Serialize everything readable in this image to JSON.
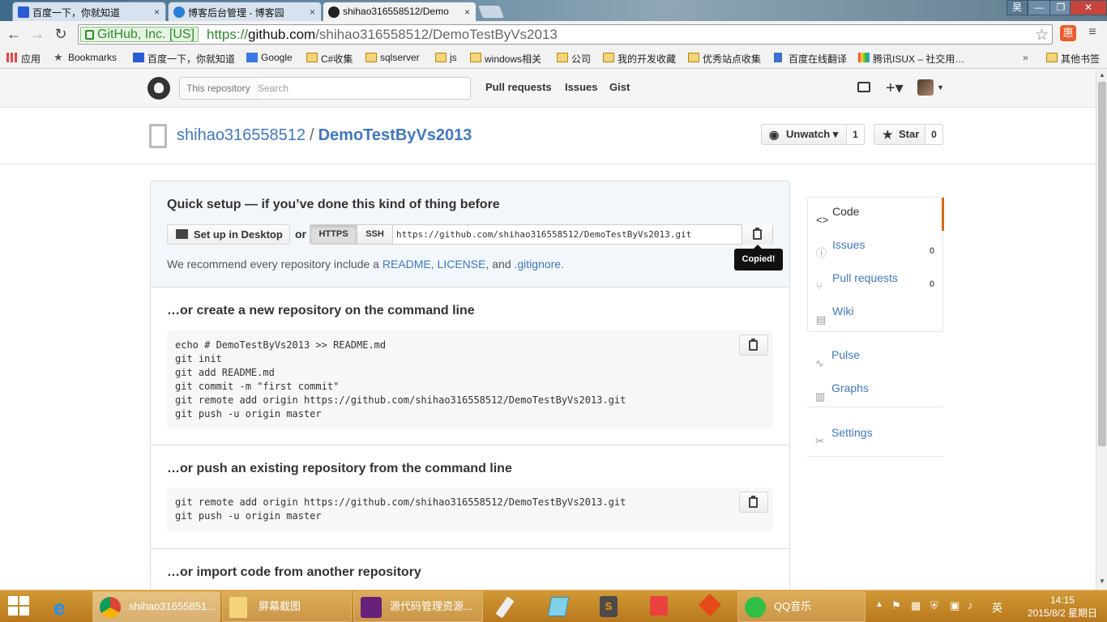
{
  "browser": {
    "tabs": [
      {
        "label": "百度一下，你就知道",
        "close": "×"
      },
      {
        "label": "博客后台管理 - 博客园",
        "close": "×"
      },
      {
        "label": "shihao316558512/Demo",
        "close": "×"
      }
    ],
    "user_chip": "昊",
    "window_buttons": {
      "minimize": "—",
      "restore": "❐",
      "close": "✕"
    },
    "nav": {
      "back": "←",
      "forward": "→",
      "reload": "↻"
    },
    "ev_label": "GitHub, Inc. [US]",
    "url_scheme": "https://",
    "url_host": "github.com",
    "url_path": "/shihao316558512/DemoTestByVs2013",
    "star": "☆",
    "menu": "≡",
    "ext_badge": "惠"
  },
  "bookmarks": {
    "items": [
      "应用",
      "Bookmarks",
      "百度一下，你就知道",
      "Google",
      "C#收集",
      "sqlserver",
      "js",
      "windows相关",
      "公司",
      "我的开发收藏",
      "优秀站点收集",
      "百度在线翻译",
      "腾讯ISUX – 社交用…"
    ],
    "overflow": "»",
    "other": "其他书签"
  },
  "github": {
    "search_scope": "This repository",
    "search_placeholder": "Search",
    "nav": [
      "Pull requests",
      "Issues",
      "Gist"
    ],
    "plus": "+▾",
    "caret": "▼"
  },
  "repo": {
    "owner": "shihao316558512",
    "separator": "/",
    "name": "DemoTestByVs2013",
    "watch_label": "Unwatch ▾",
    "watch_count": "1",
    "star_label": "Star",
    "star_count": "0"
  },
  "quick_setup": {
    "heading": "Quick setup — if you’ve done this kind of thing before",
    "desktop_label": "Set up in Desktop",
    "or": "or",
    "https": "HTTPS",
    "ssh": "SSH",
    "clone_url": "https://github.com/shihao316558512/DemoTestByVs2013.git",
    "tooltip": "Copied!",
    "recommend_prefix": "We recommend every repository include a ",
    "readme": "README",
    "comma1": ", ",
    "license": "LICENSE",
    "and": ", and ",
    "gitignore": ".gitignore",
    "dot": "."
  },
  "sections": [
    {
      "heading": "…or create a new repository on the command line",
      "code": "echo # DemoTestByVs2013 >> README.md\ngit init\ngit add README.md\ngit commit -m \"first commit\"\ngit remote add origin https://github.com/shihao316558512/DemoTestByVs2013.git\ngit push -u origin master"
    },
    {
      "heading": "…or push an existing repository from the command line",
      "code": "git remote add origin https://github.com/shihao316558512/DemoTestByVs2013.git\ngit push -u origin master"
    },
    {
      "heading": "…or import code from another repository",
      "code": ""
    }
  ],
  "sidebar": {
    "items": [
      {
        "label": "Code",
        "icon": "<>",
        "badge": ""
      },
      {
        "label": "Issues",
        "icon": "ⓘ",
        "badge": "0"
      },
      {
        "label": "Pull requests",
        "icon": "⑂",
        "badge": "0"
      },
      {
        "label": "Wiki",
        "icon": "▤",
        "badge": ""
      },
      {
        "label": "Pulse",
        "icon": "∿",
        "badge": ""
      },
      {
        "label": "Graphs",
        "icon": "▥",
        "badge": ""
      },
      {
        "label": "Settings",
        "icon": "✂",
        "badge": ""
      }
    ]
  },
  "taskbar": {
    "chrome_label": "shihao31655851...",
    "explorer_label": "屏幕截图",
    "vs_label": "源代码管理资源...",
    "qq_label": "QQ音乐",
    "ime": "英",
    "time": "14:15",
    "date": "2015/8/2 星期日"
  },
  "colors": {
    "link": "#4078c0",
    "accent": "#d26911",
    "ev_green": "#2d8c2a",
    "taskbar": "#c58a2a"
  }
}
